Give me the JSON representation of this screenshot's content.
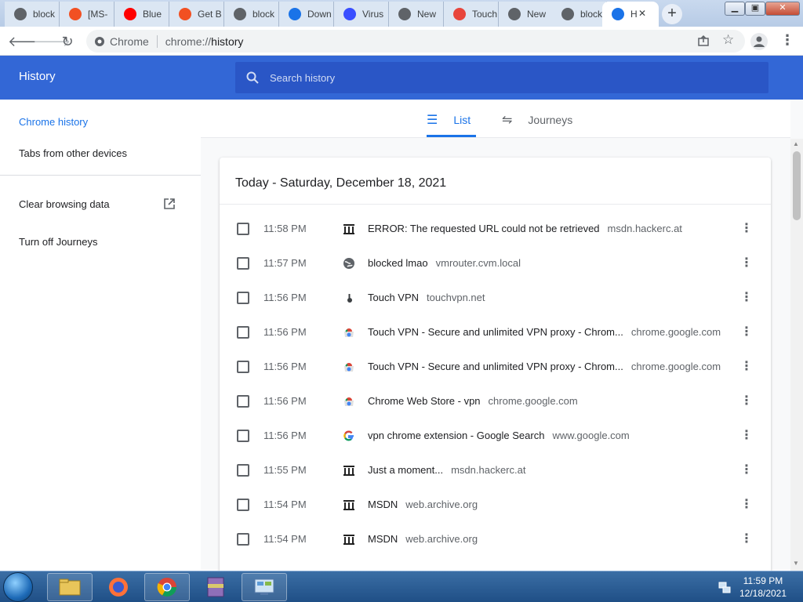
{
  "browser": {
    "tabs": [
      {
        "label": "block",
        "icon": "globe-icon",
        "color": "#5f6368"
      },
      {
        "label": "[MS-",
        "icon": "microsoft-icon",
        "color": "#f25022"
      },
      {
        "label": "Blue",
        "icon": "youtube-icon",
        "color": "#ff0000"
      },
      {
        "label": "Get B",
        "icon": "microsoft-icon",
        "color": "#f25022"
      },
      {
        "label": "block",
        "icon": "globe-icon",
        "color": "#5f6368"
      },
      {
        "label": "Down",
        "icon": "download-icon",
        "color": "#1a73e8"
      },
      {
        "label": "Virus",
        "icon": "virustotal-icon",
        "color": "#394eff"
      },
      {
        "label": "New",
        "icon": "chrome-icon",
        "color": "#5f6368"
      },
      {
        "label": "Touch",
        "icon": "webstore-icon",
        "color": "#e8453c"
      },
      {
        "label": "New",
        "icon": "chrome-icon",
        "color": "#5f6368"
      },
      {
        "label": "block",
        "icon": "globe-icon",
        "color": "#5f6368"
      },
      {
        "label": "H",
        "icon": "history-icon",
        "color": "#1a73e8",
        "active": true
      }
    ],
    "new_tab_label": "+",
    "omnibox": {
      "site_label": "Chrome",
      "url_scheme": "chrome://",
      "url_path": "history"
    }
  },
  "history_page": {
    "title": "History",
    "search_placeholder": "Search history",
    "sidebar": {
      "chrome_history": "Chrome history",
      "tabs_other_devices": "Tabs from other devices",
      "clear_browsing_data": "Clear browsing data",
      "turn_off_journeys": "Turn off Journeys"
    },
    "tabs": {
      "list": "List",
      "journeys": "Journeys"
    },
    "day_heading": "Today - Saturday, December 18, 2021",
    "entries": [
      {
        "time": "11:58 PM",
        "title": "ERROR: The requested URL could not be retrieved",
        "domain": "msdn.hackerc.at",
        "favicon": "archive-icon"
      },
      {
        "time": "11:57 PM",
        "title": "blocked lmao",
        "domain": "vmrouter.cvm.local",
        "favicon": "globe-icon"
      },
      {
        "time": "11:56 PM",
        "title": "Touch VPN",
        "domain": "touchvpn.net",
        "favicon": "touchvpn-icon"
      },
      {
        "time": "11:56 PM",
        "title": "Touch VPN - Secure and unlimited VPN proxy - Chrom...",
        "domain": "chrome.google.com",
        "favicon": "webstore-icon"
      },
      {
        "time": "11:56 PM",
        "title": "Touch VPN - Secure and unlimited VPN proxy - Chrom...",
        "domain": "chrome.google.com",
        "favicon": "webstore-icon"
      },
      {
        "time": "11:56 PM",
        "title": "Chrome Web Store - vpn",
        "domain": "chrome.google.com",
        "favicon": "webstore-icon"
      },
      {
        "time": "11:56 PM",
        "title": "vpn chrome extension - Google Search",
        "domain": "www.google.com",
        "favicon": "google-icon"
      },
      {
        "time": "11:55 PM",
        "title": "Just a moment...",
        "domain": "msdn.hackerc.at",
        "favicon": "archive-icon"
      },
      {
        "time": "11:54 PM",
        "title": "MSDN",
        "domain": "web.archive.org",
        "favicon": "archive-icon"
      },
      {
        "time": "11:54 PM",
        "title": "MSDN",
        "domain": "web.archive.org",
        "favicon": "archive-icon"
      }
    ]
  },
  "taskbar": {
    "clock_time": "11:59 PM",
    "clock_date": "12/18/2021",
    "apps": [
      "explorer-icon",
      "firefox-icon",
      "chrome-icon",
      "winrar-icon",
      "control-panel-icon"
    ]
  },
  "colors": {
    "accent": "#3367d6",
    "link_blue": "#1a73e8"
  }
}
